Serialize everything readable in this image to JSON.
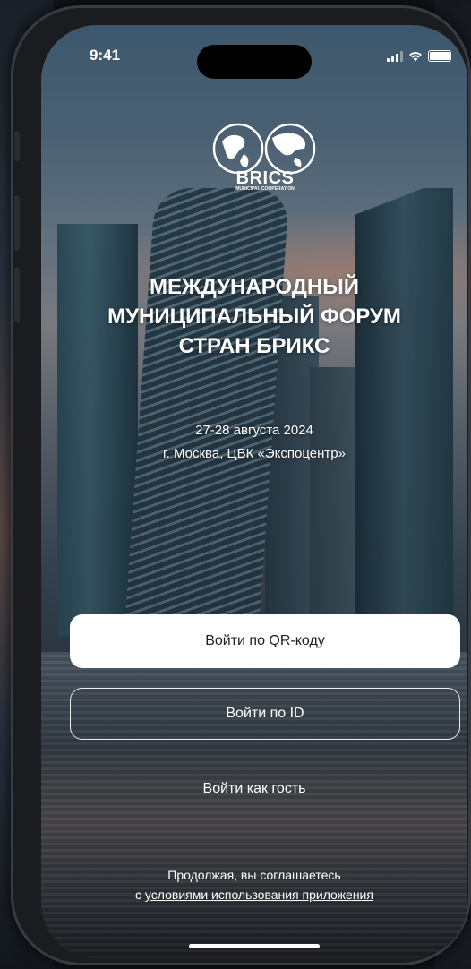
{
  "status_bar": {
    "time": "9:41",
    "icons": [
      "signal-icon",
      "wifi-icon",
      "battery-icon"
    ]
  },
  "logo": {
    "name": "BRICS",
    "subtitle": "MUNICIPAL COOPERATION"
  },
  "event": {
    "title_line1": "МЕЖДУНАРОДНЫЙ",
    "title_line2": "МУНИЦИПАЛЬНЫЙ ФОРУМ",
    "title_line3": "СТРАН БРИКС",
    "dates": "27-28 августа 2024",
    "location": "г. Москва, ЦВК «Экспоцентр»"
  },
  "actions": {
    "qr_login": "Войти по QR-коду",
    "id_login": "Войти по ID",
    "guest_login": "Войти как гость"
  },
  "terms": {
    "prefix": "Продолжая, вы соглашаетесь",
    "link_prefix": "с ",
    "link_text": "условиями использования приложения"
  },
  "colors": {
    "primary_button_bg": "#ffffff",
    "primary_button_text": "#1b1e22",
    "text": "#ffffff"
  }
}
